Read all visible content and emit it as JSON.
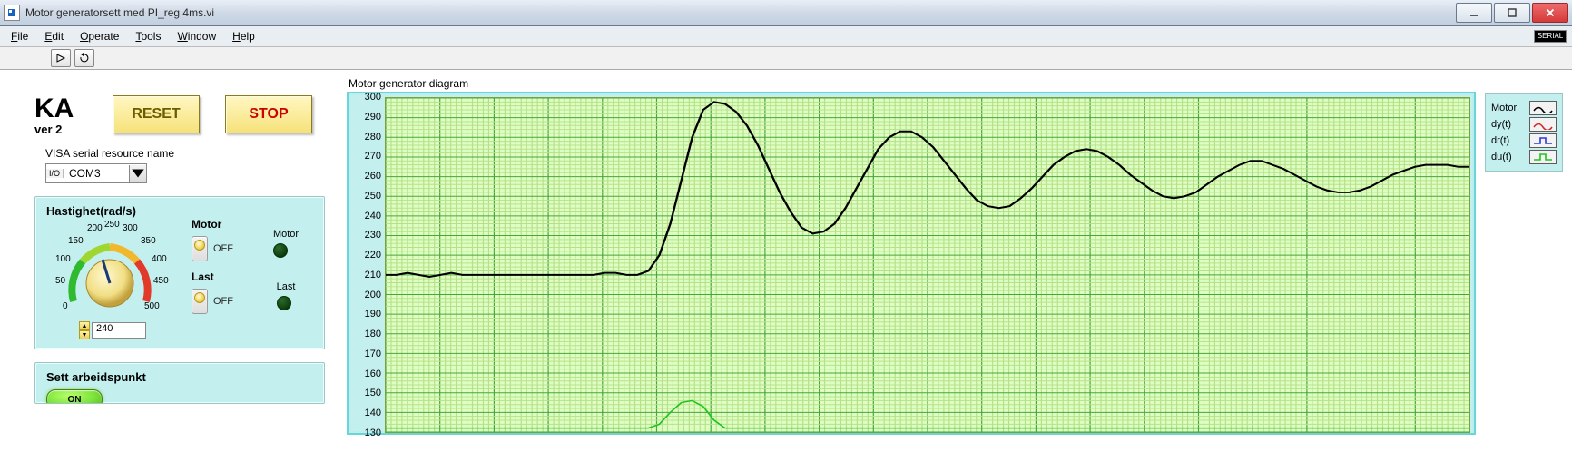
{
  "window": {
    "title": "Motor generatorsett med PI_reg 4ms.vi"
  },
  "menus": [
    "File",
    "Edit",
    "Operate",
    "Tools",
    "Window",
    "Help"
  ],
  "serial_test": "SERIAL",
  "app": {
    "name": "KA",
    "version": "ver 2"
  },
  "buttons": {
    "reset": "RESET",
    "stop": "STOP"
  },
  "visa": {
    "label": "VISA serial resource name",
    "io_tag": "I/O",
    "value": "COM3"
  },
  "hastighet": {
    "title": "Hastighet(rad/s)",
    "ticks": [
      "0",
      "50",
      "100",
      "150",
      "200",
      "250",
      "300",
      "350",
      "400",
      "450",
      "500"
    ],
    "value": "240"
  },
  "switches": {
    "motor_label": "Motor",
    "last_label": "Last",
    "off": "OFF"
  },
  "leds": {
    "motor": "Motor",
    "last": "Last"
  },
  "sett": {
    "title": "Sett arbeidspunkt",
    "on": "ON"
  },
  "chart": {
    "title": "Motor generator diagram",
    "y_ticks": [
      "300",
      "290",
      "280",
      "270",
      "260",
      "250",
      "240",
      "230",
      "220",
      "210",
      "200",
      "190",
      "180",
      "170",
      "160",
      "150",
      "140",
      "130"
    ],
    "legend": [
      {
        "name": "Motor",
        "color": "#000",
        "shape": "wave"
      },
      {
        "name": "dy(t)",
        "color": "#d42a2a",
        "shape": "wave"
      },
      {
        "name": "dr(t)",
        "color": "#2a3ad4",
        "shape": "step"
      },
      {
        "name": "du(t)",
        "color": "#1fc41f",
        "shape": "step"
      }
    ]
  },
  "chart_data": {
    "type": "line",
    "ylabel": "",
    "ylim": [
      130,
      300
    ],
    "categories_note": "x-axis scale not visible in crop",
    "series": [
      {
        "name": "Motor",
        "values": [
          210,
          210,
          211,
          210,
          209,
          210,
          211,
          210,
          210,
          210,
          210,
          210,
          210,
          210,
          210,
          210,
          210,
          210,
          210,
          210,
          211,
          211,
          210,
          210,
          212,
          220,
          236,
          258,
          280,
          294,
          298,
          297,
          293,
          286,
          276,
          264,
          252,
          242,
          234,
          231,
          232,
          236,
          244,
          254,
          264,
          274,
          280,
          283,
          283,
          280,
          275,
          268,
          261,
          254,
          248,
          245,
          244,
          245,
          249,
          254,
          260,
          266,
          270,
          273,
          274,
          273,
          270,
          266,
          261,
          257,
          253,
          250,
          249,
          250,
          252,
          256,
          260,
          263,
          266,
          268,
          268,
          266,
          264,
          261,
          258,
          255,
          253,
          252,
          252,
          253,
          255,
          258,
          261,
          263,
          265,
          266,
          266,
          266,
          265,
          265
        ]
      },
      {
        "name": "du(t)",
        "values_note": "partial visibility at bottom of chart; approximate",
        "values": [
          132,
          132,
          132,
          132,
          132,
          132,
          132,
          132,
          132,
          132,
          132,
          132,
          132,
          132,
          132,
          132,
          132,
          132,
          132,
          132,
          132,
          132,
          132,
          132,
          132,
          134,
          140,
          145,
          146,
          143,
          136,
          132,
          132,
          132,
          132,
          132,
          132,
          132,
          132,
          132,
          132,
          132,
          132,
          132,
          132,
          132,
          132,
          132,
          132,
          132,
          132,
          132,
          132,
          132,
          132,
          132,
          132,
          132,
          132,
          132,
          132,
          132,
          132,
          132,
          132,
          132,
          132,
          132,
          132,
          132,
          132,
          132,
          132,
          132,
          132,
          132,
          132,
          132,
          132,
          132,
          132,
          132,
          132,
          132,
          132,
          132,
          132,
          132,
          132,
          132,
          132,
          132,
          132,
          132,
          132,
          132,
          132,
          132,
          132,
          132
        ]
      }
    ]
  }
}
